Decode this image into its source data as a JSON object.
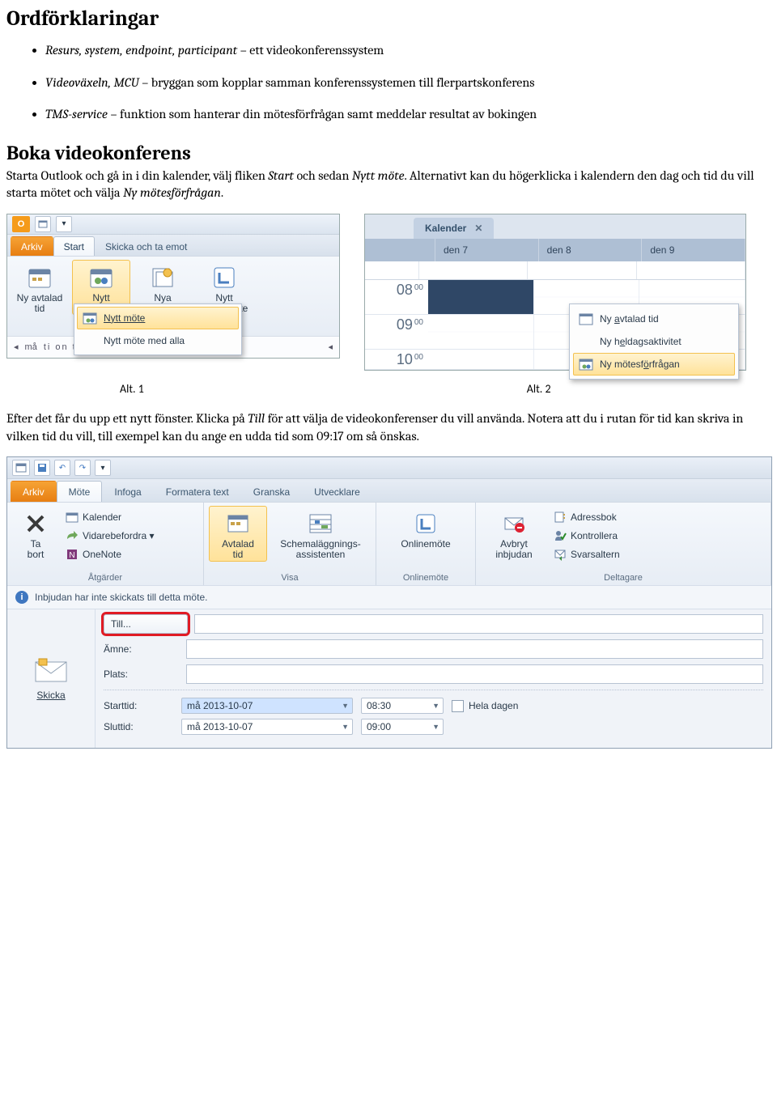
{
  "headings": {
    "h1": "Ordförklaringar",
    "h2": "Boka videokonferens"
  },
  "bullets": [
    {
      "term": "Resurs, system, endpoint, participant",
      "desc": " – ett videokonferenssystem"
    },
    {
      "term": "Videoväxeln, MCU",
      "desc": " – bryggan som kopplar samman konferenssystemen till flerpartskonferens"
    },
    {
      "term": "TMS-service",
      "desc": " – funktion som hanterar din mötesförfrågan samt meddelar resultat av bokingen"
    }
  ],
  "paragraphs": {
    "p1a": "Starta Outlook och gå in i din kalender, välj fliken ",
    "p1b": "Start",
    "p1c": " och sedan ",
    "p1d": "Nytt möte",
    "p1e": ". Alternativt kan du högerklicka i kalendern den dag och tid du vill starta mötet och välja ",
    "p1f": "Ny mötesförfrågan",
    "p1g": ".",
    "p2a": "Efter det får du upp ett nytt fönster. Klicka på ",
    "p2b": "Till",
    "p2c": " för att välja de videokonferenser du vill använda. Notera att du i rutan för tid kan skriva in vilken tid du vill, till exempel kan du ange en udda tid som 09:17 om så önskas."
  },
  "captions": {
    "alt1": "Alt. 1",
    "alt2": "Alt. 2"
  },
  "shot1": {
    "tabs": {
      "file": "Arkiv",
      "start": "Start",
      "sendreceive": "Skicka och ta emot"
    },
    "buttons": {
      "new_appt": "Ny avtalad\ntid",
      "new_meeting": "Nytt\nmöte",
      "new_items": "Nya\nobjekt",
      "new_online": "Nytt\nonlinemöte"
    },
    "menu": {
      "new_meeting": "Nytt möte",
      "new_meeting_all": "Nytt möte med alla"
    },
    "weeknav": {
      "mon": "må",
      "days": "ti   on   to   fr   lö   sö"
    }
  },
  "shot2": {
    "tab": "Kalender",
    "days": [
      "den 7",
      "den 8",
      "den 9"
    ],
    "hours": [
      {
        "hh": "08",
        "mm": "00"
      },
      {
        "hh": "09",
        "mm": "00"
      },
      {
        "hh": "10",
        "mm": "00"
      }
    ],
    "ctx": {
      "new_appt": "Ny avtalad tid",
      "new_allday": "Ny heldagsaktivitet",
      "new_meeting_req": "Ny mötesförfrågan"
    }
  },
  "shot3": {
    "tabs": {
      "file": "Arkiv",
      "meeting": "Möte",
      "insert": "Infoga",
      "format": "Formatera text",
      "review": "Granska",
      "dev": "Utvecklare"
    },
    "groups": {
      "actions": {
        "title": "Åtgärder",
        "delete": "Ta\nbort",
        "calendar": "Kalender",
        "forward": "Vidarebefordra",
        "onenote": "OneNote"
      },
      "show": {
        "title": "Visa",
        "appt": "Avtalad\ntid",
        "sched": "Schemaläggnings-\nassistenten"
      },
      "online": {
        "title": "Onlinemöte",
        "btn": "Onlinemöte"
      },
      "attendees": {
        "title": "Deltagare",
        "cancel": "Avbryt\ninbjudan",
        "addrbook": "Adressbok",
        "checknames": "Kontrollera",
        "respopts": "Svarsaltern"
      }
    },
    "infobar": "Inbjudan har inte skickats till detta möte.",
    "form": {
      "send": "Skicka",
      "to": "Till...",
      "subject": "Ämne:",
      "location": "Plats:",
      "starttime": "Starttid:",
      "endtime": "Sluttid:",
      "date": "må 2013-10-07",
      "time_start": "08:30",
      "time_end": "09:00",
      "allday": "Hela dagen"
    }
  }
}
